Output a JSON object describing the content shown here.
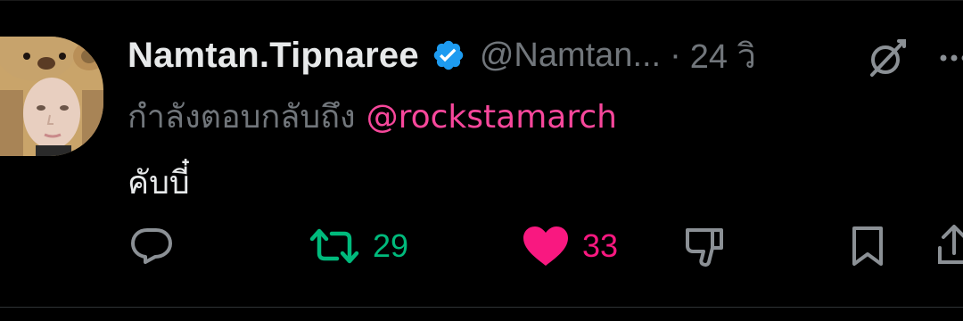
{
  "tweet": {
    "display_name": "Namtan.Tipnaree",
    "handle": "@Namtan...",
    "separator": "·",
    "time": "24 วิ",
    "reply_prefix": "กำลังตอบกลับถึง",
    "reply_mention": "@rockstamarch",
    "text": "คับบี๋"
  },
  "actions": {
    "reply": {
      "icon": "reply-icon",
      "count": ""
    },
    "retweet": {
      "icon": "retweet-icon",
      "count": "29"
    },
    "like": {
      "icon": "heart-icon",
      "count": "33",
      "liked": true
    },
    "downvote": {
      "icon": "downvote-icon"
    },
    "bookmark": {
      "icon": "bookmark-icon"
    },
    "share": {
      "icon": "share-icon"
    }
  },
  "colors": {
    "background": "#000000",
    "text": "#e7e9ea",
    "secondary": "#71767b",
    "mention": "#f7479b",
    "retweet": "#00ba7c",
    "like": "#f91880",
    "verified": "#1d9bf0"
  }
}
